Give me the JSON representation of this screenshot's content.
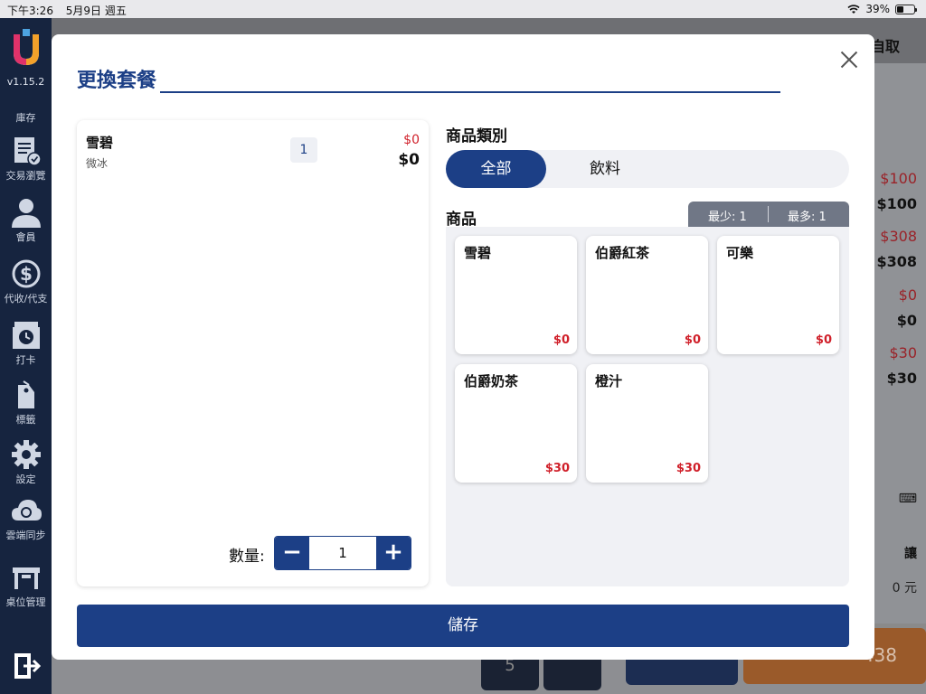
{
  "status_bar": {
    "time": "下午3:26",
    "date": "5月9日 週五",
    "battery": "39%",
    "battery_level": 0.39
  },
  "sidebar": {
    "version": "v1.15.2",
    "items": [
      {
        "label": "庫存",
        "icon": "box-icon"
      },
      {
        "label": "交易瀏覽",
        "icon": "receipt-icon"
      },
      {
        "label": "會員",
        "icon": "user-icon"
      },
      {
        "label": "代收/代支",
        "icon": "dollar-icon"
      },
      {
        "label": "打卡",
        "icon": "clock-in-icon"
      },
      {
        "label": "標籤",
        "icon": "tag-icon"
      },
      {
        "label": "設定",
        "icon": "gear-icon"
      },
      {
        "label": "雲端同步",
        "icon": "cloud-sync-icon"
      },
      {
        "label": "桌位管理",
        "icon": "table-icon"
      }
    ],
    "logout_icon": "logout-icon"
  },
  "background": {
    "top_right_text": "自取",
    "prices": [
      {
        "red": "$100",
        "dark": "$100"
      },
      {
        "red": "$308",
        "dark": "$308"
      },
      {
        "red": "$0",
        "dark": "$0"
      },
      {
        "red": "$30",
        "dark": "$30"
      }
    ],
    "side_label": "讓",
    "side_value": "0 元",
    "keypad_5": "5",
    "total_partial": "438"
  },
  "modal": {
    "title": "更換套餐",
    "selected": {
      "name": "雪碧",
      "note": "微冰",
      "qty_badge": "1",
      "original_price": "$0",
      "price": "$0"
    },
    "qty_label": "數量:",
    "qty_value": "1",
    "category_label": "商品類別",
    "categories": [
      {
        "label": "全部",
        "active": true
      },
      {
        "label": "飲料",
        "active": false
      }
    ],
    "product_label": "商品",
    "limit_min": "最少: 1",
    "limit_max": "最多: 1",
    "products": [
      {
        "name": "雪碧",
        "price": "$0"
      },
      {
        "name": "伯爵紅茶",
        "price": "$0"
      },
      {
        "name": "可樂",
        "price": "$0"
      },
      {
        "name": "伯爵奶茶",
        "price": "$30"
      },
      {
        "name": "橙汁",
        "price": "$30"
      }
    ],
    "save_label": "儲存"
  }
}
